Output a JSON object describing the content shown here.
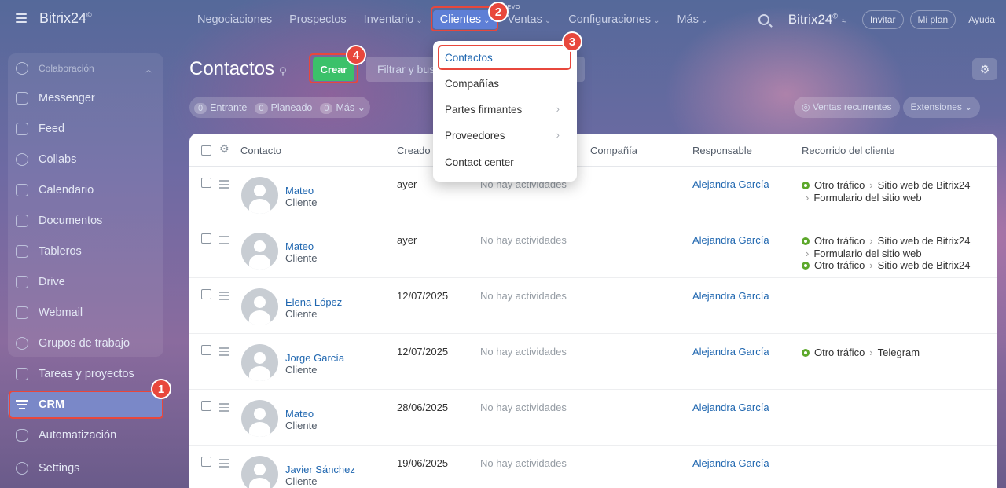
{
  "app": {
    "brand": "Bitrix24",
    "brand_mark": "©"
  },
  "topnav": {
    "items": [
      {
        "label": "Negociaciones",
        "chevron": false
      },
      {
        "label": "Prospectos",
        "chevron": false
      },
      {
        "label": "Inventario",
        "chevron": true
      },
      {
        "label": "Clientes",
        "chevron": true,
        "active": true
      },
      {
        "label": "Ventas",
        "chevron": true,
        "badge": "NUEVO"
      },
      {
        "label": "Configuraciones",
        "chevron": true
      },
      {
        "label": "Más",
        "chevron": true
      }
    ],
    "right": {
      "brand": "Bitrix24",
      "invitar": "Invitar",
      "mi_plan": "Mi plan",
      "ayuda": "Ayuda"
    }
  },
  "sidebar": {
    "group_title": "Colaboración",
    "items": [
      {
        "label": "Messenger",
        "icon": "messenger-icon"
      },
      {
        "label": "Feed",
        "icon": "feed-icon"
      },
      {
        "label": "Collabs",
        "icon": "collabs-icon"
      },
      {
        "label": "Calendario",
        "icon": "calendar-icon"
      },
      {
        "label": "Documentos",
        "icon": "document-icon"
      },
      {
        "label": "Tableros",
        "icon": "board-icon"
      },
      {
        "label": "Drive",
        "icon": "drive-icon"
      },
      {
        "label": "Webmail",
        "icon": "mail-icon"
      },
      {
        "label": "Grupos de trabajo",
        "icon": "groups-icon"
      }
    ],
    "tasks": "Tareas y proyectos",
    "crm": "CRM",
    "automation": "Automatización",
    "settings": "Settings"
  },
  "page": {
    "title": "Contactos",
    "create_button": "Crear",
    "filter_placeholder": "Filtrar y buscar",
    "counters": [
      {
        "count": "0",
        "label": "Entrante"
      },
      {
        "count": "0",
        "label": "Planeado"
      },
      {
        "count": "0",
        "label": "Más"
      }
    ],
    "right_chips": [
      "Ventas recurrentes",
      "Extensiones"
    ]
  },
  "table": {
    "headers": {
      "contact": "Contacto",
      "created": "Creado",
      "company": "Compañía",
      "responsible": "Responsable",
      "journey": "Recorrido del cliente"
    },
    "rows": [
      {
        "name": "Mateo",
        "type": "Cliente",
        "created": "ayer",
        "activity": "No hay actividades",
        "responsible": "Alejandra García",
        "journey": [
          "Otro tráfico",
          "Sitio web de Bitrix24",
          "Formulario del sitio web"
        ]
      },
      {
        "name": "Mateo",
        "type": "Cliente",
        "created": "ayer",
        "activity": "No hay actividades",
        "responsible": "Alejandra García",
        "journey": [
          "Otro tráfico",
          "Sitio web de Bitrix24",
          "Formulario del sitio web"
        ],
        "journey2": [
          "Otro tráfico",
          "Sitio web de Bitrix24"
        ]
      },
      {
        "name": "Elena López",
        "type": "Cliente",
        "created": "12/07/2025",
        "activity": "No hay actividades",
        "responsible": "Alejandra García"
      },
      {
        "name": "Jorge García",
        "type": "Cliente",
        "created": "12/07/2025",
        "activity": "No hay actividades",
        "responsible": "Alejandra García",
        "journey": [
          "Otro tráfico",
          "Telegram"
        ]
      },
      {
        "name": "Mateo",
        "type": "Cliente",
        "created": "28/06/2025",
        "activity": "No hay actividades",
        "responsible": "Alejandra García"
      },
      {
        "name": "Javier Sánchez",
        "type": "Cliente",
        "created": "19/06/2025",
        "activity": "No hay actividades",
        "responsible": "Alejandra García"
      }
    ]
  },
  "dropdown": {
    "items": [
      {
        "label": "Contactos",
        "active": true
      },
      {
        "label": "Compañías"
      },
      {
        "label": "Partes firmantes",
        "submenu": true
      },
      {
        "label": "Proveedores",
        "submenu": true
      },
      {
        "label": "Contact center"
      }
    ]
  },
  "callouts": [
    "1",
    "2",
    "3",
    "4"
  ],
  "colors": {
    "accent": "#e8473c",
    "crear": "#3bc16a",
    "link": "#2067b0",
    "active_nav": "#5e7fd6"
  }
}
